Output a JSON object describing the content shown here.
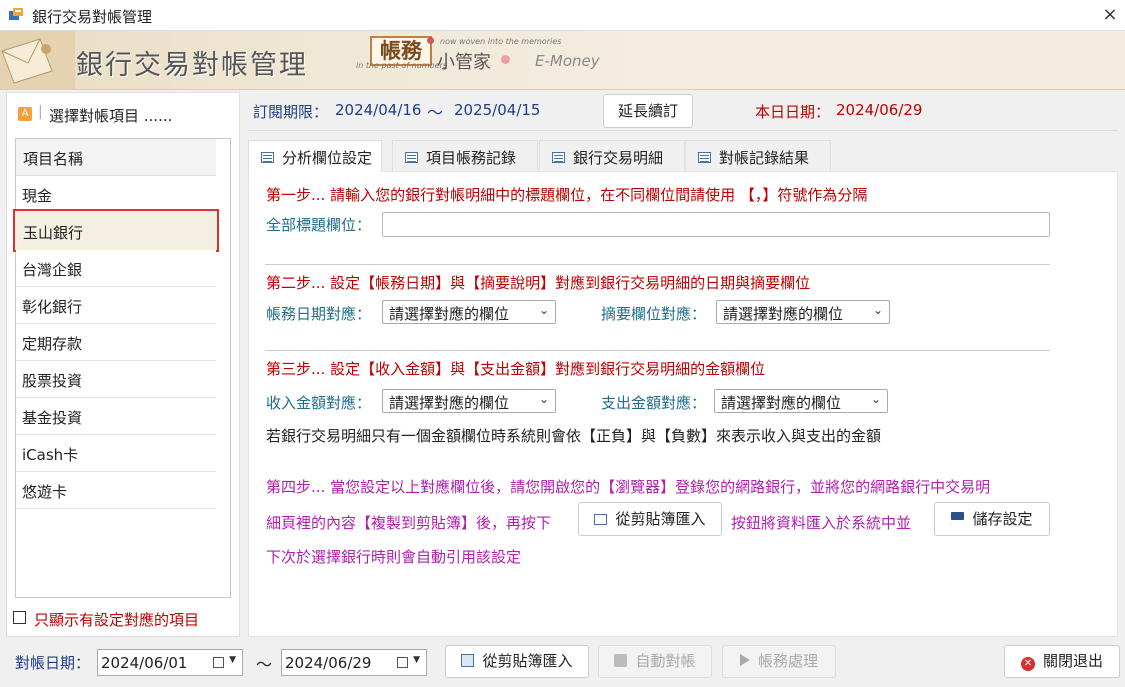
{
  "window": {
    "title": "銀行交易對帳管理",
    "close_glyph": "×"
  },
  "banner": {
    "title": "銀行交易對帳管理",
    "logo_main": "帳務",
    "logo_sub1": "now woven into the memories",
    "logo_sub2": "in the past of numbers",
    "logo_cn": "小管家",
    "logo_em": "E-Money"
  },
  "left": {
    "icon_letter": "A",
    "sep": "|",
    "title": "選擇對帳項目 ......",
    "header": "項目名稱",
    "items": [
      {
        "label": "現金"
      },
      {
        "label": "玉山銀行"
      },
      {
        "label": "台灣企銀"
      },
      {
        "label": "彰化銀行"
      },
      {
        "label": "定期存款"
      },
      {
        "label": "股票投資"
      },
      {
        "label": "基金投資"
      },
      {
        "label": "iCash卡"
      },
      {
        "label": "悠遊卡"
      }
    ],
    "selected_index": 1,
    "only_mapped_label": "只顯示有設定對應的項目"
  },
  "header": {
    "sub_label": "訂閱期限：",
    "sub_from": "2024/04/16",
    "tilde": "～",
    "sub_to": "2025/04/15",
    "extend_button": "延長續訂",
    "today_label": "本日日期：",
    "today_value": "2024/06/29"
  },
  "tabs": [
    {
      "label": "分析欄位設定"
    },
    {
      "label": "項目帳務記錄"
    },
    {
      "label": "銀行交易明細"
    },
    {
      "label": "對帳記錄結果"
    }
  ],
  "step1": {
    "text": "第一步... 請輸入您的銀行對帳明細中的標題欄位，在不同欄位間請使用 【，】符號作為分隔",
    "field_label": "全部標題欄位：",
    "field_value": ""
  },
  "step2": {
    "text": "第二步... 設定【帳務日期】與【摘要說明】對應到銀行交易明細的日期與摘要欄位",
    "date_label": "帳務日期對應：",
    "date_select": "請選擇對應的欄位",
    "summary_label": "摘要欄位對應：",
    "summary_select": "請選擇對應的欄位"
  },
  "step3": {
    "text": "第三步... 設定【收入金額】與【支出金額】對應到銀行交易明細的金額欄位",
    "income_label": "收入金額對應：",
    "income_select": "請選擇對應的欄位",
    "expense_label": "支出金額對應：",
    "expense_select": "請選擇對應的欄位",
    "note": "若銀行交易明細只有一個金額欄位時系統則會依【正負】與【負數】來表示收入與支出的金額"
  },
  "step4": {
    "line1": "第四步... 當您設定以上對應欄位後，請您開啟您的【瀏覽器】登錄您的網路銀行，並將您的網路銀行中交易明",
    "line2a": "細頁裡的內容【複製到剪貼簿】後，再按下",
    "paste_button": "從剪貼簿匯入",
    "line2b": "按鈕將資料匯入於系統中並",
    "save_button": "儲存設定",
    "line3": "下次於選擇銀行時則會自動引用該設定"
  },
  "footer": {
    "date_label": "對帳日期：",
    "date_from": "2024/06/01",
    "tilde": "～",
    "date_to": "2024/06/29",
    "paste_button": "從剪貼簿匯入",
    "auto_button": "自動對帳",
    "process_button": "帳務處理",
    "exit_button": "關閉退出"
  },
  "colors": {
    "accent_red": "#c00000",
    "label_blue": "#1f3d8a",
    "teal": "#1f6e8c",
    "magenta": "#b01fae",
    "selection_border": "#e0302f"
  }
}
